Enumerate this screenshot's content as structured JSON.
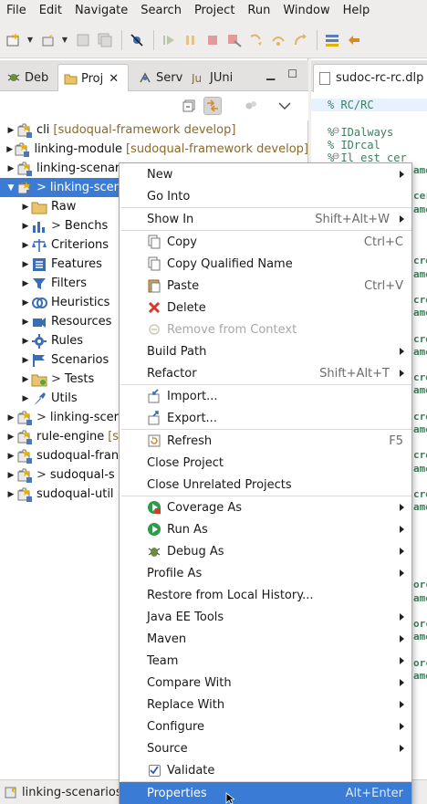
{
  "menubar": [
    "File",
    "Edit",
    "Navigate",
    "Search",
    "Project",
    "Run",
    "Window",
    "Help"
  ],
  "view_tabs": [
    {
      "label": "Deb",
      "icon": "debug-icon"
    },
    {
      "label": "Proj",
      "icon": "folder-icon",
      "close": "✕"
    },
    {
      "label": "Serv",
      "icon": "servers-icon"
    },
    {
      "label": "JUni",
      "icon": "junit-icon"
    }
  ],
  "tree": [
    {
      "label": "cli",
      "decoration": "[sudoqual-framework develop]",
      "prefix": "",
      "expanded": false,
      "selected": false
    },
    {
      "label": "linking-module",
      "decoration": "[sudoqual-framework develop]",
      "prefix": "",
      "expanded": false,
      "selected": false
    },
    {
      "label": "linking-scenar",
      "decoration": "",
      "prefix": "",
      "expanded": false,
      "selected": false
    },
    {
      "label": "linking-scen",
      "decoration": "",
      "prefix": ">",
      "expanded": true,
      "selected": true
    },
    {
      "label": "Raw",
      "prefix": "",
      "selected": false
    },
    {
      "label": "Benchs",
      "prefix": ">",
      "selected": false
    },
    {
      "label": "Criterions",
      "prefix": "",
      "selected": false
    },
    {
      "label": "Features",
      "prefix": "",
      "selected": false
    },
    {
      "label": "Filters",
      "prefix": "",
      "selected": false
    },
    {
      "label": "Heuristics",
      "prefix": "",
      "selected": false
    },
    {
      "label": "Resources",
      "prefix": "",
      "selected": false
    },
    {
      "label": "Rules",
      "prefix": "",
      "selected": false
    },
    {
      "label": "Scenarios",
      "prefix": "",
      "selected": false
    },
    {
      "label": "Tests",
      "prefix": ">",
      "selected": false
    },
    {
      "label": "Utils",
      "prefix": "",
      "selected": false
    },
    {
      "label": "linking-scer",
      "decoration": "",
      "prefix": ">",
      "expanded": false,
      "selected": false
    },
    {
      "label": "rule-engine",
      "decoration": "[s",
      "prefix": "",
      "expanded": false,
      "selected": false
    },
    {
      "label": "sudoqual-fran",
      "decoration": "",
      "prefix": "",
      "expanded": false,
      "selected": false
    },
    {
      "label": "sudoqual-s",
      "decoration": "",
      "prefix": ">",
      "expanded": false,
      "selected": false
    },
    {
      "label": "sudoqual-util",
      "decoration": "",
      "prefix": "",
      "expanded": false,
      "selected": false
    }
  ],
  "status": {
    "text": "linking-scenarios"
  },
  "editor": {
    "tab_label": "sudoc-rc-rc.dlp",
    "lines": [
      "% RC/RC",
      "",
      "% IDalways",
      "% IDrcal",
      "% Il est cer"
    ],
    "fragments": [
      "ame",
      "",
      "cer",
      "ame",
      "",
      "",
      "",
      "crê",
      "ame",
      "",
      "crê",
      "ame",
      "",
      "crê",
      "ame",
      "",
      "crê",
      "ame",
      "",
      "crê",
      "ame",
      "",
      "crê",
      "ame",
      "",
      "crê",
      "ame",
      "",
      "",
      "",
      "",
      "",
      "orc",
      "ame",
      "",
      "orc",
      "ame",
      "",
      "orc",
      "ame"
    ]
  },
  "context_menu": [
    {
      "label": "New",
      "submenu": true
    },
    {
      "label": "Go Into"
    },
    {
      "sep": true
    },
    {
      "label": "Show In",
      "accel": "Shift+Alt+W",
      "submenu": true
    },
    {
      "sep": true
    },
    {
      "label": "Copy",
      "accel": "Ctrl+C",
      "icon": "copy-icon"
    },
    {
      "label": "Copy Qualified Name",
      "icon": "copy-qualified-name-icon"
    },
    {
      "label": "Paste",
      "accel": "Ctrl+V",
      "icon": "paste-icon"
    },
    {
      "label": "Delete",
      "icon": "delete-icon"
    },
    {
      "label": "Remove from Context",
      "icon": "remove-context-icon",
      "disabled": true
    },
    {
      "label": "Build Path",
      "submenu": true
    },
    {
      "label": "Refactor",
      "accel": "Shift+Alt+T",
      "submenu": true
    },
    {
      "sep": true
    },
    {
      "label": "Import...",
      "icon": "import-icon"
    },
    {
      "label": "Export...",
      "icon": "export-icon"
    },
    {
      "sep": true
    },
    {
      "label": "Refresh",
      "accel": "F5",
      "icon": "refresh-icon"
    },
    {
      "label": "Close Project"
    },
    {
      "label": "Close Unrelated Projects"
    },
    {
      "sep": true
    },
    {
      "label": "Coverage As",
      "icon": "coverage-icon",
      "submenu": true
    },
    {
      "label": "Run As",
      "icon": "run-icon",
      "submenu": true
    },
    {
      "label": "Debug As",
      "icon": "debug-icon",
      "submenu": true
    },
    {
      "label": "Profile As",
      "submenu": true
    },
    {
      "label": "Restore from Local History..."
    },
    {
      "label": "Java EE Tools",
      "submenu": true
    },
    {
      "label": "Maven",
      "submenu": true
    },
    {
      "label": "Team",
      "submenu": true
    },
    {
      "label": "Compare With",
      "submenu": true
    },
    {
      "label": "Replace With",
      "submenu": true
    },
    {
      "label": "Configure",
      "submenu": true
    },
    {
      "label": "Source",
      "submenu": true
    },
    {
      "label": "Validate",
      "icon": "checkbox-icon",
      "checked": true
    },
    {
      "sep": true
    },
    {
      "label": "Properties",
      "accel": "Alt+Enter",
      "active": true
    }
  ],
  "colors": {
    "selection": "#3a7bd5",
    "decoration": "#8a6a2a",
    "comment": "#3f7f5f"
  }
}
